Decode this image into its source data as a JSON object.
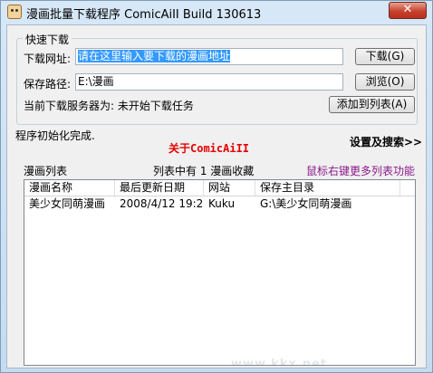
{
  "window": {
    "title": "漫画批量下载程序 ComicAiII Build 130613",
    "close_label": "✕"
  },
  "quick_download": {
    "group_title": "快速下载",
    "url_label": "下载网址:",
    "url_value": "请在这里输入要下载的漫画地址",
    "download_button": "下载(G)",
    "save_label": "保存路径:",
    "save_value": "E:\\漫画",
    "browse_button": "浏览(O)",
    "server_label": "当前下载服务器为: 未开始下载任务",
    "add_button": "添加到列表(A)"
  },
  "status_text": "程序初始化完成.",
  "about_link": "关于ComicAiII",
  "settings_link": "设置及搜索>>",
  "list_header": {
    "title": "漫画列表",
    "count_text": "列表中有  1  漫画收藏",
    "hint": "鼠标右键更多列表功能"
  },
  "listview": {
    "columns": [
      "漫画名称",
      "最后更新日期",
      "网站",
      "保存主目录"
    ],
    "rows": [
      [
        "美少女同萌漫画",
        "2008/4/12 19:2...",
        "Kuku",
        "G:\\美少女同萌漫画"
      ]
    ]
  },
  "watermark": "www.kkx.net"
}
